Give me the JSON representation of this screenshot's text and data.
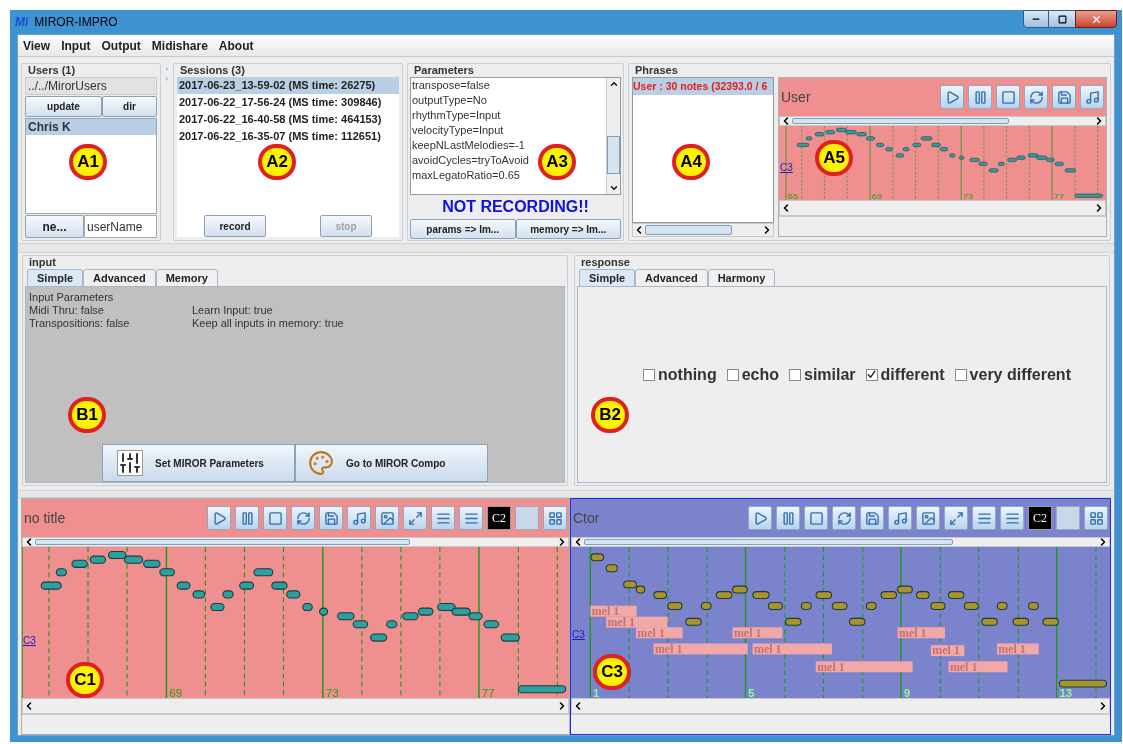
{
  "window": {
    "logo": "Mi",
    "title": "MIROR-IMPRO"
  },
  "menu": [
    "View",
    "Input",
    "Output",
    "Midishare",
    "About"
  ],
  "users": {
    "title": "Users (1)",
    "path": "../../MirorUsers",
    "buttons": [
      "update",
      "dir"
    ],
    "items": [
      {
        "label": "Chris K",
        "selected": true
      }
    ],
    "new_button": "ne...",
    "name_field": "userName"
  },
  "sessions": {
    "title": "Sessions (3)",
    "items": [
      {
        "label": "2017-06-23_13-59-02 (MS time: 26275)",
        "selected": true
      },
      {
        "label": "2017-06-22_17-56-24 (MS time: 309846)",
        "selected": false
      },
      {
        "label": "2017-06-22_16-40-58 (MS time: 464153)",
        "selected": false
      },
      {
        "label": "2017-06-22_16-35-07 (MS time: 112651)",
        "selected": false
      }
    ],
    "record": {
      "label": "record",
      "disabled": false
    },
    "stop": {
      "label": "stop",
      "disabled": true
    }
  },
  "parameters": {
    "title": "Parameters",
    "lines": [
      "transpose=false",
      "outputType=No",
      "rhythmType=Input",
      "velocityType=Input",
      "keepNLastMelodies=-1",
      "avoidCycles=tryToAvoid",
      "maxLegatoRatio=0.65"
    ],
    "status": "NOT RECORDING!!",
    "buttons": [
      "params => Im...",
      "memory => Im..."
    ]
  },
  "phrases": {
    "title": "Phrases",
    "items": [
      {
        "label": "User : 30 notes (32393.0 / 6",
        "selected": true
      }
    ]
  },
  "user_roll": {
    "title": "User",
    "pitch_label": "C3",
    "bar_labels": [
      "65",
      "69",
      "73",
      "77"
    ]
  },
  "input": {
    "title": "input",
    "tabs": [
      {
        "label": "Simple",
        "selected": true
      },
      {
        "label": "Advanced",
        "selected": false
      },
      {
        "label": "Memory",
        "selected": false
      }
    ],
    "heading": "Input Parameters",
    "settings": [
      "Midi Thru: false",
      "Learn Input: true",
      "Transpositions: false",
      "Keep all inputs in memory: true"
    ],
    "buttons": [
      "Set MIROR Parameters",
      "Go to MIROR Compo"
    ]
  },
  "response": {
    "title": "response",
    "tabs": [
      {
        "label": "Simple",
        "selected": true
      },
      {
        "label": "Advanced",
        "selected": false
      },
      {
        "label": "Harmony",
        "selected": false
      }
    ],
    "options": [
      {
        "label": "nothing",
        "checked": false
      },
      {
        "label": "echo",
        "checked": false
      },
      {
        "label": "similar",
        "checked": false
      },
      {
        "label": "different",
        "checked": true
      },
      {
        "label": "very different",
        "checked": false
      }
    ]
  },
  "input_roll": {
    "title": "no title",
    "toolbar_label": "C2",
    "pitch_label": "C3",
    "bar_labels": [
      "69",
      "73",
      "77"
    ]
  },
  "response_roll": {
    "title": "Ctor",
    "toolbar_label": "C2",
    "pitch_label": "C3",
    "bar_labels": [
      "1",
      "5",
      "9",
      "13"
    ],
    "melody_labels": [
      "mel 1",
      "mel 1",
      "mel 1",
      "mel 1",
      "mel 1",
      "mel 1",
      "mel 1",
      "mel 1",
      "mel 1",
      "mel 1",
      "mel 1"
    ]
  },
  "callouts": [
    {
      "label": "A1"
    },
    {
      "label": "A2"
    },
    {
      "label": "A3"
    },
    {
      "label": "A4"
    },
    {
      "label": "A5"
    },
    {
      "label": "B1"
    },
    {
      "label": "B2"
    },
    {
      "label": "C1"
    },
    {
      "label": "C3"
    }
  ]
}
